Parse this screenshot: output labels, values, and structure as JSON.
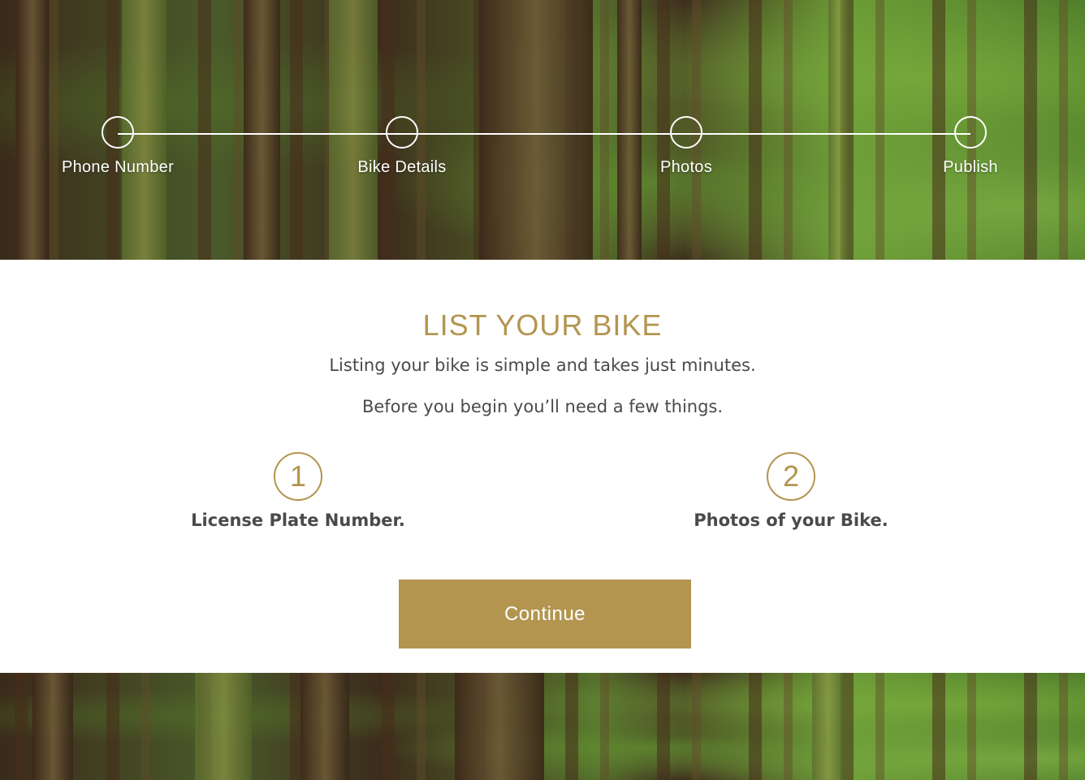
{
  "stepper": {
    "steps": [
      {
        "label": "Phone Number"
      },
      {
        "label": "Bike Details"
      },
      {
        "label": "Photos"
      },
      {
        "label": "Publish"
      }
    ]
  },
  "main": {
    "title": "LIST YOUR BIKE",
    "subtitle_1": "Listing your bike is simple and takes just minutes.",
    "subtitle_2": "Before you begin you’ll need a few things.",
    "requirements": [
      {
        "number": "1",
        "label": "License Plate Number."
      },
      {
        "number": "2",
        "label": "Photos of your Bike."
      }
    ],
    "continue_label": "Continue"
  },
  "colors": {
    "accent": "#b3954f",
    "body_text": "#4a4a4a",
    "panel_background": "#ffffff"
  }
}
